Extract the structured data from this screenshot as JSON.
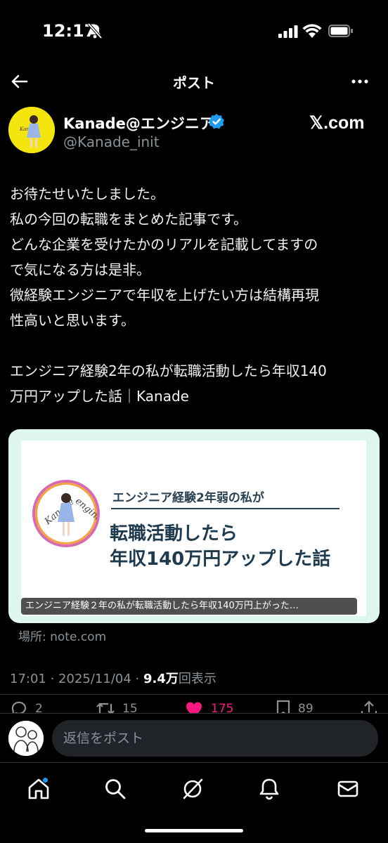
{
  "status_bar": {
    "time": "12:17"
  },
  "header": {
    "title": "ポスト"
  },
  "author": {
    "name": "Kanade@エンジニア",
    "handle": "@Kanade_init",
    "brand": "𝕏.com"
  },
  "post": {
    "lines": [
      "お待たせいたしました。",
      "私の今回の転職をまとめた記事です。",
      "どんな企業を受けたかのリアルを記載してますの",
      "で気になる方は是非。",
      "微経験エンジニアで年収を上げたい方は結構再現",
      "性高いと思います。",
      "",
      "エンジニア経験2年の私が転職活動したら年収140",
      "万円アップした話｜Kanade"
    ]
  },
  "card": {
    "logo_text_left": "Kanade",
    "logo_text_right": "engineer",
    "subtitle": "エンジニア経験2年弱の私が",
    "title_line1": "転職活動したら",
    "title_line2": "年収140万円アップした話",
    "caption": "エンジニア経験２年の私が転職活動したら年収140万円上がった…",
    "source": "場所: note.com"
  },
  "meta": {
    "timestamp": "17:01 · 2025/11/04 · ",
    "views_count": "9.4万",
    "views_label": "回表示"
  },
  "actions": {
    "replies": "2",
    "reposts": "15",
    "likes": "175",
    "bookmarks": "89",
    "like_color": "#f91880"
  },
  "reply": {
    "placeholder": "返信をポスト"
  },
  "tabs": [
    "home-icon",
    "search-icon",
    "grok-icon",
    "notifications-icon",
    "messages-icon"
  ],
  "colors": {
    "verified": "#1d9bf0",
    "background": "#000000",
    "secondary_text": "#8b9298"
  }
}
